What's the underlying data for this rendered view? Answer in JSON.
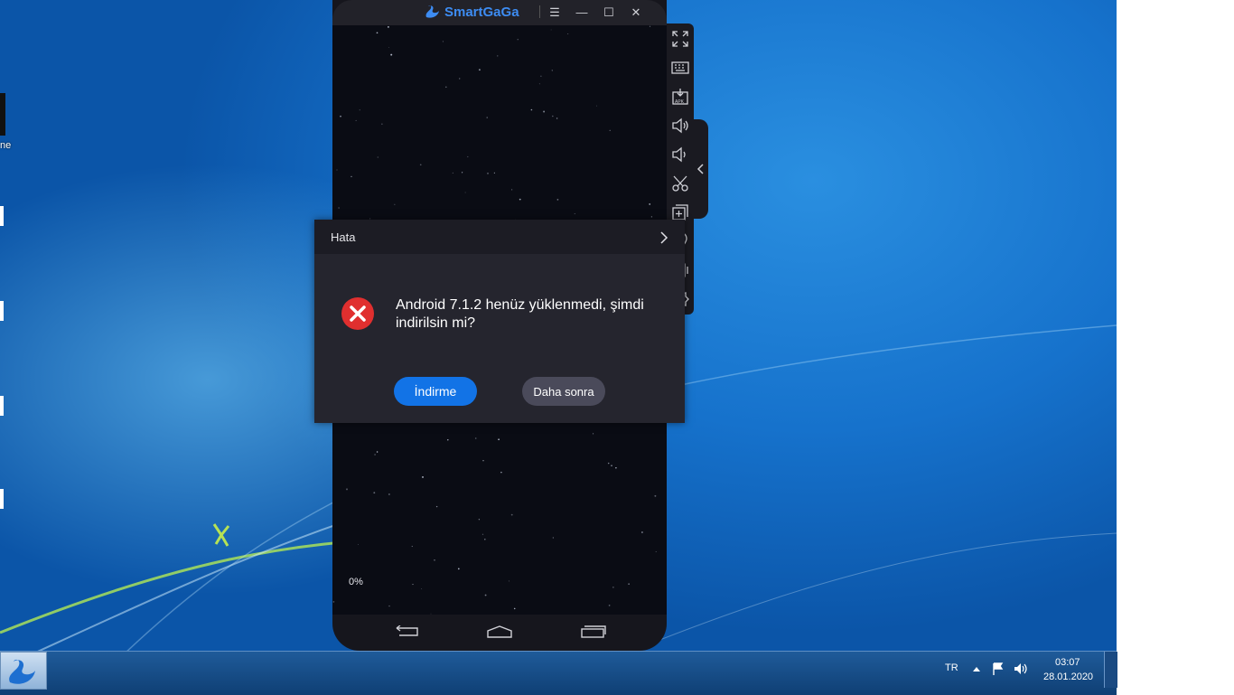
{
  "app": {
    "title": "SmartGaGa"
  },
  "emulator": {
    "progress_percent": 0,
    "progress_label": "0%",
    "sidebar_tools": [
      "fullscreen-icon",
      "keyboard-icon",
      "apk-install-icon",
      "volume-up-icon",
      "volume-down-icon",
      "screenshot-cut-icon",
      "multi-instance-icon",
      "location-icon",
      "shake-icon",
      "settings-icon"
    ],
    "nav_buttons": [
      "back-icon",
      "home-icon",
      "recents-icon"
    ]
  },
  "dialog": {
    "title": "Hata",
    "message": "Android 7.1.2 henüz yüklenmedi, şimdi indirilsin mi?",
    "primary_button": "İndirme",
    "secondary_button": "Daha sonra"
  },
  "desktop": {
    "icon_label_fragment": "ne"
  },
  "taskbar": {
    "language": "TR",
    "time": "03:07",
    "date": "28.01.2020"
  },
  "colors": {
    "accent": "#1273e6",
    "error": "#e02f2f",
    "logo": "#3d8cf2"
  }
}
